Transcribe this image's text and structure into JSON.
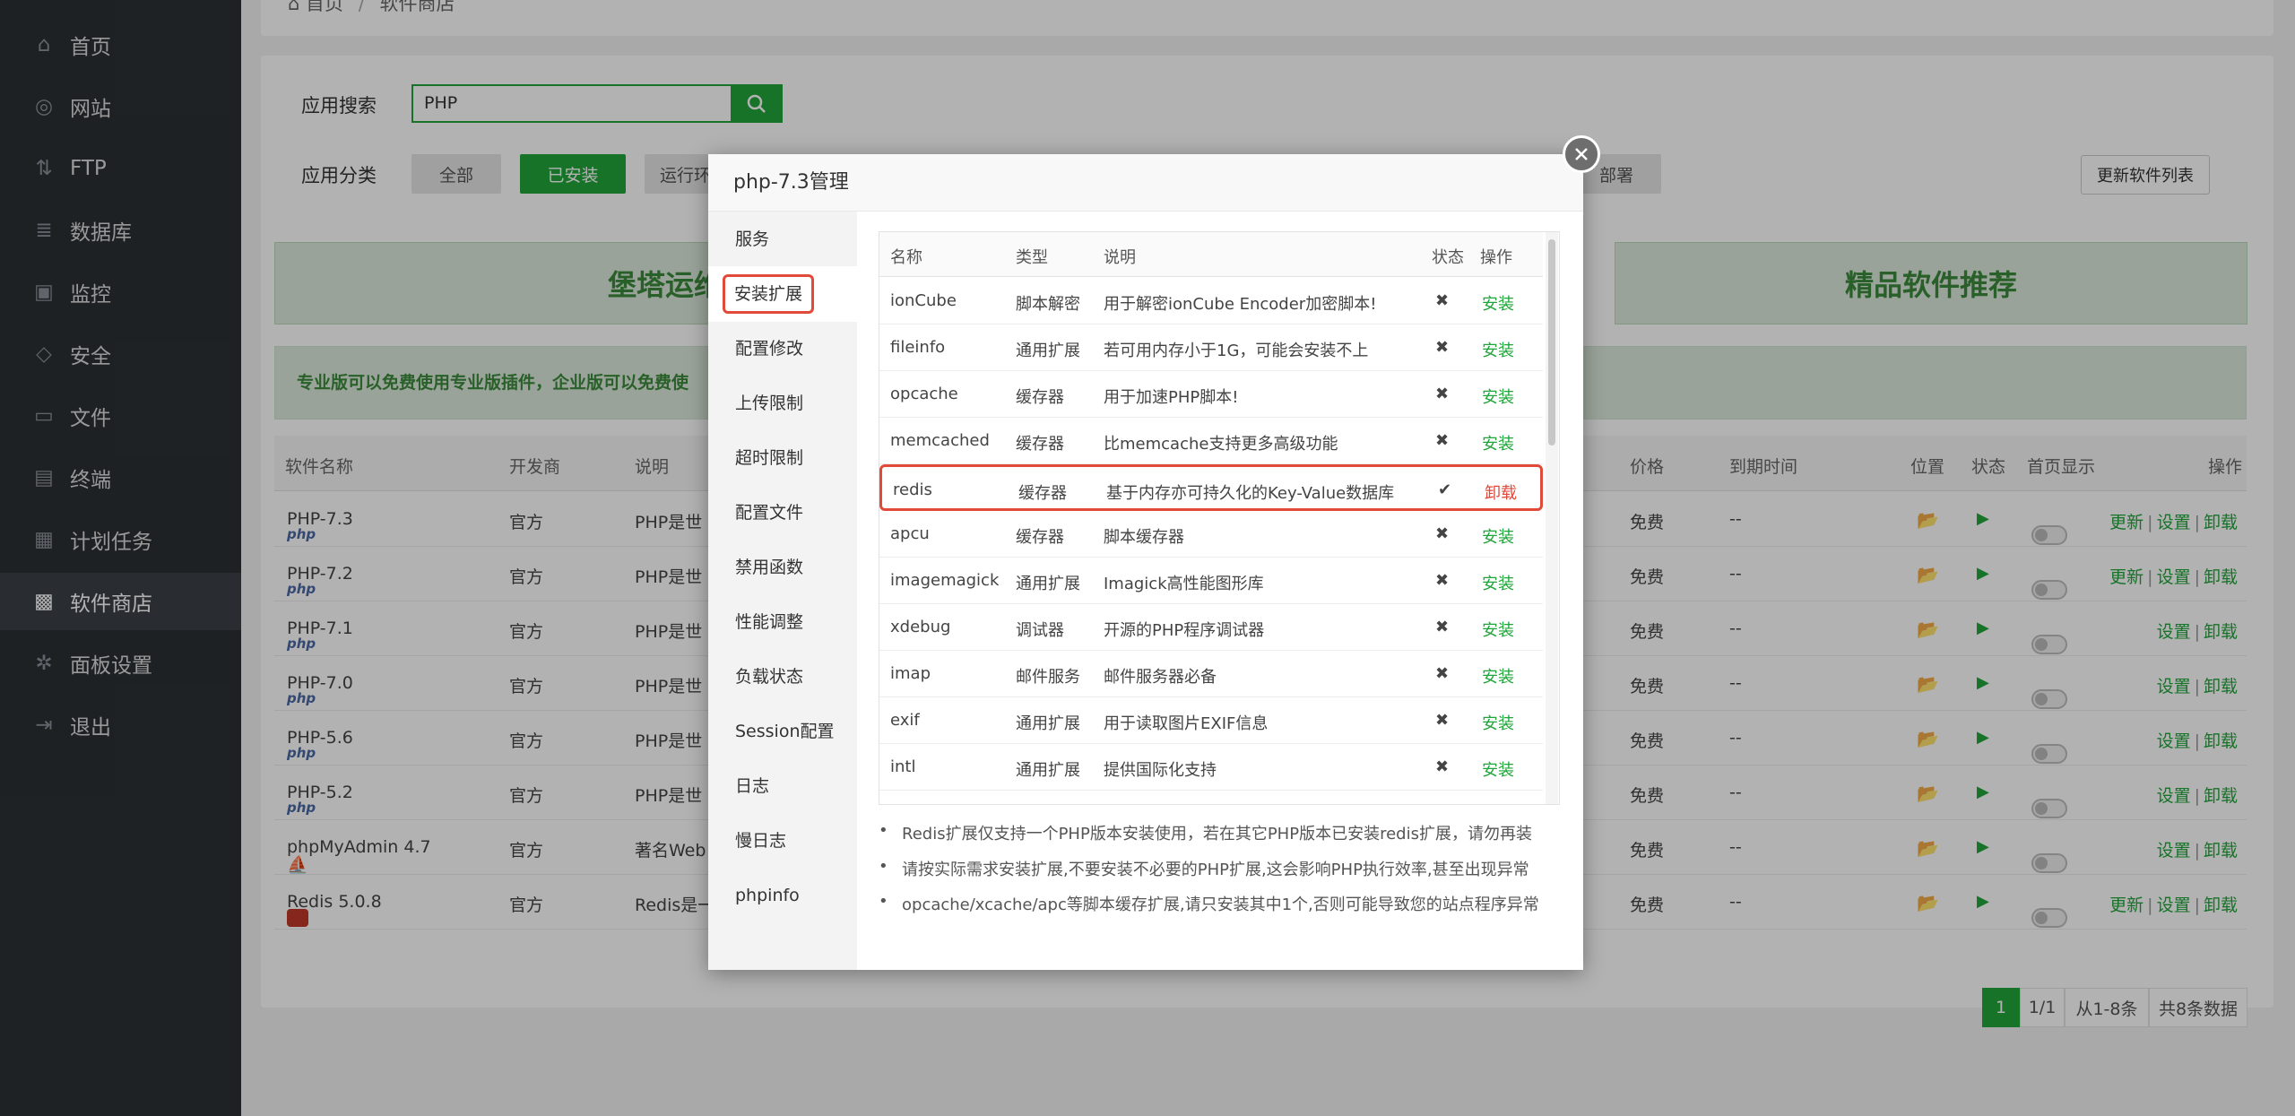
{
  "sidebar": {
    "items": [
      {
        "label": "首页",
        "icon": "home-icon",
        "icon_char": "⌂"
      },
      {
        "label": "网站",
        "icon": "globe-icon",
        "icon_char": "◎"
      },
      {
        "label": "FTP",
        "icon": "ftp-icon",
        "icon_char": "⇅"
      },
      {
        "label": "数据库",
        "icon": "database-icon",
        "icon_char": "≣"
      },
      {
        "label": "监控",
        "icon": "monitor-icon",
        "icon_char": "▣"
      },
      {
        "label": "安全",
        "icon": "shield-icon",
        "icon_char": "◇"
      },
      {
        "label": "文件",
        "icon": "folder-icon",
        "icon_char": "▭"
      },
      {
        "label": "终端",
        "icon": "terminal-icon",
        "icon_char": "▤"
      },
      {
        "label": "计划任务",
        "icon": "calendar-icon",
        "icon_char": "▦"
      },
      {
        "label": "软件商店",
        "icon": "grid-icon",
        "icon_char": "▩"
      },
      {
        "label": "面板设置",
        "icon": "gear-icon",
        "icon_char": "✲"
      },
      {
        "label": "退出",
        "icon": "logout-icon",
        "icon_char": "⇥"
      }
    ],
    "active_index": 9
  },
  "breadcrumb": {
    "home": "首页",
    "sep": "/",
    "current": "软件商店"
  },
  "store": {
    "search_label": "应用搜索",
    "search_value": "PHP",
    "category_label": "应用分类",
    "categories": [
      "全部",
      "已安装",
      "运行环境"
    ],
    "hidden_category_tail": "部署",
    "update_list_button": "更新软件列表",
    "banner_left": "堡塔运维直播答疑",
    "banner_right": "精品软件推荐",
    "tip": "专业版可以免费使用专业版插件，企业版可以免费使",
    "headers": [
      "软件名称",
      "开发商",
      "说明",
      "价格",
      "到期时间",
      "位置",
      "状态",
      "首页显示",
      "操作"
    ],
    "rows": [
      {
        "name": "PHP-7.3",
        "dev": "官方",
        "desc": "PHP是世",
        "price": "免费",
        "expire": "--",
        "ops": "更新 | 设置 | 卸载"
      },
      {
        "name": "PHP-7.2",
        "dev": "官方",
        "desc": "PHP是世",
        "price": "免费",
        "expire": "--",
        "ops": "更新 | 设置 | 卸载"
      },
      {
        "name": "PHP-7.1",
        "dev": "官方",
        "desc": "PHP是世",
        "price": "免费",
        "expire": "--",
        "ops": "设置 | 卸载"
      },
      {
        "name": "PHP-7.0",
        "dev": "官方",
        "desc": "PHP是世",
        "price": "免费",
        "expire": "--",
        "ops": "设置 | 卸载"
      },
      {
        "name": "PHP-5.6",
        "dev": "官方",
        "desc": "PHP是世",
        "price": "免费",
        "expire": "--",
        "ops": "设置 | 卸载"
      },
      {
        "name": "PHP-5.2",
        "dev": "官方",
        "desc": "PHP是世",
        "price": "免费",
        "expire": "--",
        "ops": "设置 | 卸载"
      },
      {
        "name": "phpMyAdmin 4.7",
        "dev": "官方",
        "desc": "著名Web",
        "price": "免费",
        "expire": "--",
        "ops": "设置 | 卸载"
      },
      {
        "name": "Redis 5.0.8",
        "dev": "官方",
        "desc": "Redis是一",
        "price": "免费",
        "expire": "--",
        "ops": "更新 | 设置 | 卸载"
      }
    ],
    "php_badge": "php",
    "pagination": {
      "current": "1",
      "pages": "1/1",
      "range": "从1-8条",
      "total": "共8条数据"
    }
  },
  "modal": {
    "title": "php-7.3管理",
    "menu": [
      "服务",
      "安装扩展",
      "配置修改",
      "上传限制",
      "超时限制",
      "配置文件",
      "禁用函数",
      "性能调整",
      "负载状态",
      "Session配置",
      "日志",
      "慢日志",
      "phpinfo"
    ],
    "selected_menu_index": 1,
    "ext_headers": [
      "名称",
      "类型",
      "说明",
      "状态",
      "操作"
    ],
    "extensions": [
      {
        "name": "ionCube",
        "type": "脚本解密",
        "desc": "用于解密ionCube Encoder加密脚本!",
        "status": "✖",
        "op": "安装"
      },
      {
        "name": "fileinfo",
        "type": "通用扩展",
        "desc": "若可用内存小于1G，可能会安装不上",
        "status": "✖",
        "op": "安装"
      },
      {
        "name": "opcache",
        "type": "缓存器",
        "desc": "用于加速PHP脚本!",
        "status": "✖",
        "op": "安装"
      },
      {
        "name": "memcached",
        "type": "缓存器",
        "desc": "比memcache支持更多高级功能",
        "status": "✖",
        "op": "安装"
      },
      {
        "name": "redis",
        "type": "缓存器",
        "desc": "基于内存亦可持久化的Key-Value数据库",
        "status": "✔",
        "op": "卸载"
      },
      {
        "name": "apcu",
        "type": "缓存器",
        "desc": "脚本缓存器",
        "status": "✖",
        "op": "安装"
      },
      {
        "name": "imagemagick",
        "type": "通用扩展",
        "desc": "Imagick高性能图形库",
        "status": "✖",
        "op": "安装"
      },
      {
        "name": "xdebug",
        "type": "调试器",
        "desc": "开源的PHP程序调试器",
        "status": "✖",
        "op": "安装"
      },
      {
        "name": "imap",
        "type": "邮件服务",
        "desc": "邮件服务器必备",
        "status": "✖",
        "op": "安装"
      },
      {
        "name": "exif",
        "type": "通用扩展",
        "desc": "用于读取图片EXIF信息",
        "status": "✖",
        "op": "安装"
      },
      {
        "name": "intl",
        "type": "通用扩展",
        "desc": "提供国际化支持",
        "status": "✖",
        "op": "安装"
      }
    ],
    "highlight_ext_index": 4,
    "notes": [
      "Redis扩展仅支持一个PHP版本安装使用，若在其它PHP版本已安装redis扩展，请勿再装",
      "请按实际需求安装扩展,不要安装不必要的PHP扩展,这会影响PHP执行效率,甚至出现异常",
      "opcache/xcache/apc等脚本缓存扩展,请只安装其中1个,否则可能导致您的站点程序异常"
    ]
  },
  "colors": {
    "accent": "#20a53a",
    "danger": "#e14a39",
    "sidebar": "#2c3034"
  }
}
